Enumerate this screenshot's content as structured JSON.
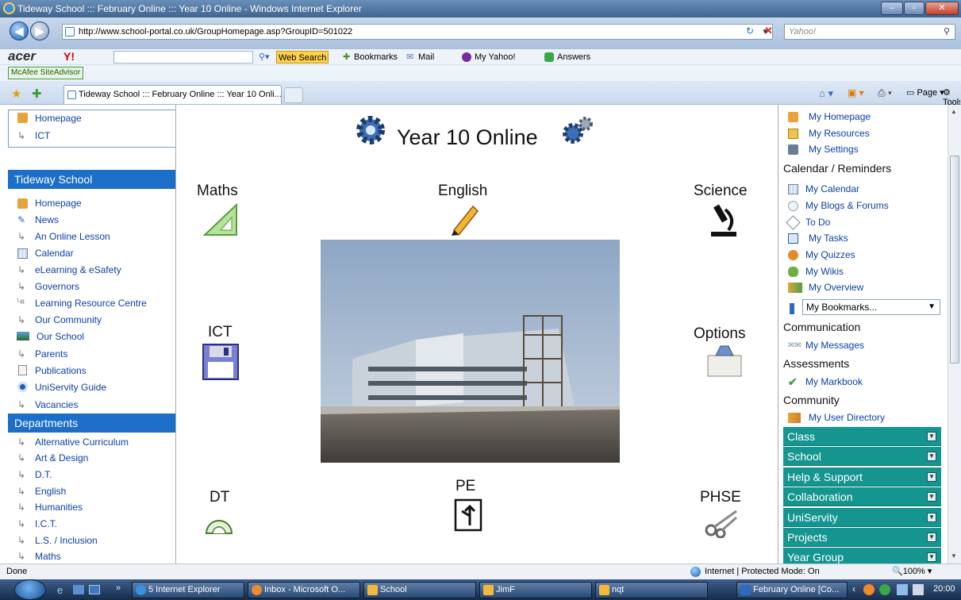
{
  "window": {
    "title": "Tideway School ::: February Online ::: Year 10 Online - Windows Internet Explorer"
  },
  "browser": {
    "address": "http://www.school-portal.co.uk/GroupHomepage.asp?GroupID=501022",
    "search_placeholder": "Yahoo!",
    "toolbar": {
      "brand": "acer",
      "yahoo": "Y!",
      "web_search": "Web Search",
      "bookmarks": "Bookmarks",
      "mail": "Mail",
      "my_yahoo": "My Yahoo!",
      "answers": "Answers"
    },
    "mcafee": "McAfee SiteAdvisor",
    "tab_title": "Tideway School ::: February Online ::: Year 10 Onli...",
    "commands": {
      "page": "Page",
      "tools": "Tools"
    }
  },
  "left": {
    "crumbs": [
      "Homepage",
      "ICT"
    ],
    "school_title": "Tideway School",
    "school_links": [
      "Homepage",
      "News",
      "An Online Lesson",
      "Calendar",
      "eLearning & eSafety",
      "Governors",
      "Learning Resource Centre",
      "Our Community",
      "Our School",
      "Parents",
      "Publications",
      "UniServity Guide",
      "Vacancies"
    ],
    "departments_title": "Departments",
    "department_links": [
      "Alternative Curriculum",
      "Art & Design",
      "D.T.",
      "English",
      "Humanities",
      "I.C.T.",
      "L.S. / Inclusion",
      "Maths"
    ]
  },
  "center": {
    "title": "Year 10 Online",
    "subjects": {
      "maths": "Maths",
      "english": "English",
      "science": "Science",
      "ict": "ICT",
      "options": "Options",
      "dt": "DT",
      "pe": "PE",
      "phse": "PHSE"
    }
  },
  "right": {
    "top_links": [
      "My Homepage",
      "My Resources",
      "My Settings"
    ],
    "calendar_head": "Calendar / Reminders",
    "calendar_links": [
      "My Calendar",
      "My Blogs & Forums",
      "To Do",
      "My Tasks",
      "My Quizzes",
      "My Wikis",
      "My Overview"
    ],
    "bookmarks_select": "My Bookmarks...",
    "communication_head": "Communication",
    "messages": "My Messages",
    "assessments_head": "Assessments",
    "markbook": "My Markbook",
    "community_head": "Community",
    "user_directory": "My User Directory",
    "sections": [
      "Class",
      "School",
      "Help & Support",
      "Collaboration",
      "UniServity",
      "Projects",
      "Year Group"
    ]
  },
  "status": {
    "left": "Done",
    "zone": "Internet | Protected Mode: On",
    "zoom": "100%"
  },
  "taskbar": {
    "items": [
      "5 Internet Explorer",
      "Inbox - Microsoft O...",
      "School",
      "JimF",
      "nqt",
      "February Online [Co..."
    ],
    "clock": "20:00"
  }
}
